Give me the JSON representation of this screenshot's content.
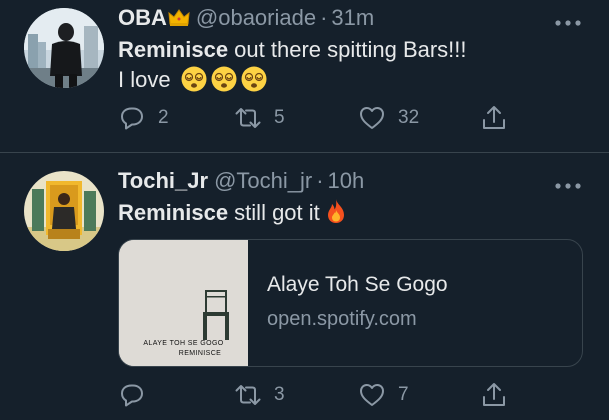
{
  "tweets": [
    {
      "name": "OBA",
      "handle": "@obaoriade",
      "separator": "·",
      "time": "31m",
      "text_bold": "Reminisce",
      "text_rest": " out there spitting Bars!!!",
      "text_line2": "I love",
      "emojis": [
        "dizzy-face-emoji",
        "dizzy-face-emoji",
        "dizzy-face-emoji"
      ],
      "replies": "2",
      "retweets": "5",
      "likes": "32"
    },
    {
      "name": "Tochi_Jr",
      "handle": "@Tochi_jr",
      "separator": "·",
      "time": "10h",
      "text_bold": "Reminisce",
      "text_rest": " still got it",
      "emoji": "fire-emoji",
      "card": {
        "title": "Alaye Toh Se Gogo",
        "domain": "open.spotify.com",
        "album_text_line1": "ALAYE TOH SE GOGO",
        "album_text_line2": "REMINISCE"
      },
      "replies": "",
      "retweets": "3",
      "likes": "7"
    }
  ],
  "icons": [
    "more-icon",
    "reply-icon",
    "retweet-icon",
    "like-icon",
    "share-icon",
    "crown-emoji"
  ],
  "colors": {
    "background": "#15202b",
    "text": "#e7e9ea",
    "muted": "#8b98a5",
    "divider": "#38444d"
  }
}
